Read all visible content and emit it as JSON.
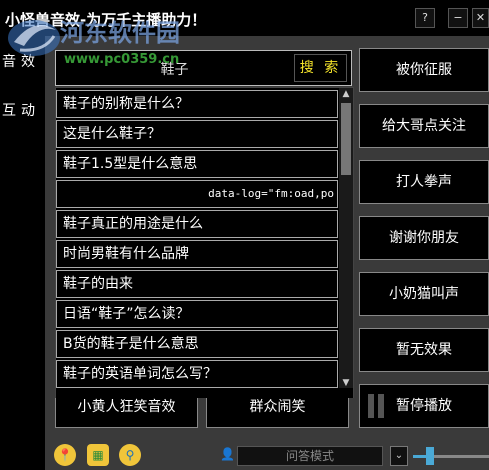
{
  "window": {
    "title": "小怪兽音效-为万千主播助力！",
    "help_label": "?",
    "minimize_label": "−",
    "close_label": "✕"
  },
  "watermark": {
    "site": "河东软件园",
    "url": "www.pc0359.cn"
  },
  "sidebar": {
    "items": [
      {
        "label": "音效"
      },
      {
        "label": "互动"
      }
    ]
  },
  "search": {
    "value": "鞋子",
    "button_label": "搜 索"
  },
  "results": [
    "鞋子的别称是什么？",
    "这是什么鞋子？",
    "鞋子1.5型是什么意思",
    "data-log=\"fm:oad,po",
    "鞋子真正的用途是什么",
    "时尚男鞋有什么品牌",
    "鞋子的由来",
    "日语“鞋子”怎么读？",
    "B货的鞋子是什么意思",
    "鞋子的英语单词怎么写？"
  ],
  "bottom_buttons": [
    {
      "label": "小黄人狂笑音效"
    },
    {
      "label": "群众闹笑"
    }
  ],
  "right_buttons": [
    {
      "label": "被你征服"
    },
    {
      "label": "给大哥点关注"
    },
    {
      "label": "打人拳声"
    },
    {
      "label": "谢谢你朋友"
    },
    {
      "label": "小奶猫叫声"
    },
    {
      "label": "暂无效果"
    },
    {
      "label": "暂停播放"
    }
  ],
  "footer": {
    "mode_label": "问答模式",
    "volume_level": 0.22,
    "tool_icons": [
      "location-icon",
      "calculator-icon",
      "search-icon"
    ]
  },
  "colors": {
    "background": "#000000",
    "panel": "#3a3a3a",
    "search_button_text": "#f6e52a",
    "volume_accent": "#4aa9d6"
  }
}
